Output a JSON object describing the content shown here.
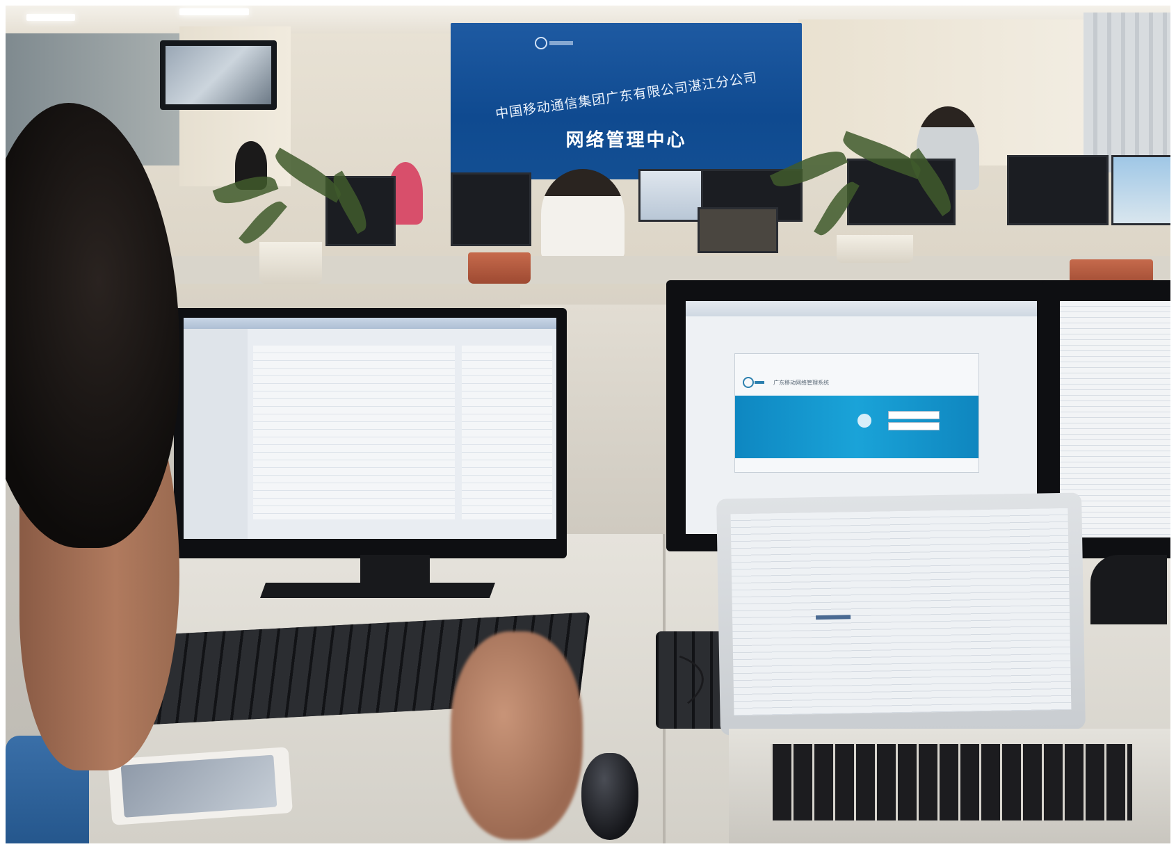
{
  "scene": {
    "banner": {
      "company_line": "中国移动通信集团广东有限公司湛江分公司",
      "title": "网络管理中心"
    },
    "center_monitor": {
      "login_page_title": "广东移动网络管理系统"
    }
  },
  "colors": {
    "banner_blue": "#134f93",
    "login_band_blue": "#1aa3d8",
    "shirt_blue": "#2d629a"
  },
  "icons": {
    "banner_logo": "china-mobile-logo-icon",
    "login_logo": "china-mobile-logo-icon"
  }
}
